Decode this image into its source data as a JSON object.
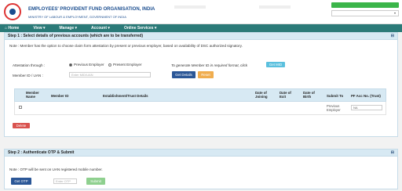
{
  "header": {
    "org_title": "EMPLOYEES' PROVIDENT FUND ORGANISATION, INDIA",
    "org_subtitle": "MINISTRY OF LABOUR & EMPLOYMENT, GOVERNMENT OF INDIA",
    "user_menu_glyph": "▾"
  },
  "nav": {
    "items": [
      {
        "label": "⌂ Home"
      },
      {
        "label": "View ▾"
      },
      {
        "label": "Manage ▾"
      },
      {
        "label": "Account ▾"
      },
      {
        "label": "Online Services ▾"
      }
    ]
  },
  "step1": {
    "title": "Step 1 : Select details of previous accounts (which are to be transferred)",
    "collapse_icon": "⊟",
    "note": "Note : Member has the option to choose claim form attestation by present or previous employer, based on availability of DSC authorized signatory.",
    "attestation_label": "Attestation through :",
    "option_previous": "Previous Employer",
    "option_present": "Present Employer",
    "generate_hint": "To generate Member ID in required format, click",
    "get_mid_label": "Get MID",
    "member_id_label": "Member ID / UAN :",
    "member_id_placeholder": "Enter MID/UAN",
    "get_details_label": "Get Details",
    "reset_label": "Reset",
    "table": {
      "headers": [
        "Member Name",
        "Member ID",
        "Establishment/Trust Details",
        "Date of Joining",
        "Date of Exit",
        "Date of Birth",
        "Submit To",
        "PF Acc No. (Trust)"
      ],
      "row": {
        "submit_to": "Previous Employer",
        "pf_acc": "NA"
      }
    },
    "delete_label": "Delete"
  },
  "step2": {
    "title": "Step 2 : Authenticate OTP & Submit",
    "collapse_icon": "⊟",
    "note": "Note : OTP will be sent on UAN registered mobile number.",
    "get_otp_label": "Get OTP",
    "otp_placeholder": "Enter OTP",
    "submit_label": "Submit"
  }
}
